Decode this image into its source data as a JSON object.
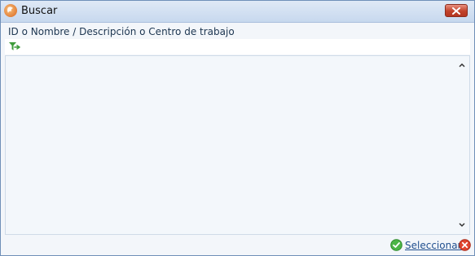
{
  "window": {
    "title": "Buscar"
  },
  "search": {
    "label": "ID o Nombre / Descripción o Centro de trabajo"
  },
  "footer": {
    "select_label": "Seleccionar"
  },
  "icons": {
    "app": "app-logo-icon",
    "close": "close-icon",
    "filter": "filter-arrow-icon",
    "select": "check-circle-icon",
    "cancel": "cancel-circle-icon"
  },
  "colors": {
    "titlebar": "#c7d8ee",
    "close_button": "#c1412a",
    "link": "#1f4e8e",
    "check": "#3ea33a",
    "cancel": "#d23a2a"
  }
}
